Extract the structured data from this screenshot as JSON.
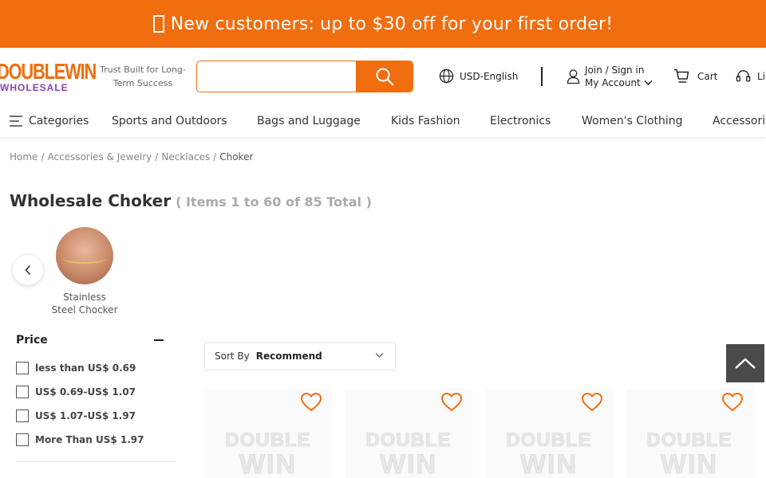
{
  "promo": {
    "text": "New customers: up to $30 off for your first order!"
  },
  "header": {
    "logo_top": "DOUBLEWIN",
    "logo_bottom": "WHOLESALE",
    "tagline": "Trust Built for Long-Term Success",
    "search_placeholder": "",
    "currency_label": "USD-English",
    "account_line1": "Join / Sign in",
    "account_line2": "My Account",
    "cart_label": "Cart",
    "help_label": "Li"
  },
  "nav": {
    "categories_label": "Categories",
    "items": [
      "Sports and Outdoors",
      "Bags and Luggage",
      "Kids Fashion",
      "Electronics",
      "Women's Clothing",
      "Accessori"
    ]
  },
  "breadcrumb": {
    "items": [
      "Home",
      "Accessories & Jewelry",
      "Necklaces"
    ],
    "current": "Choker"
  },
  "page": {
    "title": "Wholesale Choker",
    "count": "( Items 1 to 60 of 85 Total )"
  },
  "subcategories": [
    {
      "label": "Stainless Steel Chocker"
    }
  ],
  "filters": {
    "price_title": "Price",
    "price_options": [
      "less than US$ 0.69",
      "US$ 0.69-US$ 1.07",
      "US$ 1.07-US$ 1.97",
      "More Than US$ 1.97"
    ]
  },
  "sort": {
    "label": "Sort By",
    "value": "Recommend"
  },
  "products": [
    {
      "placeholder_top": "DOUBLE",
      "placeholder_bottom": "WIN"
    },
    {
      "placeholder_top": "DOUBLE",
      "placeholder_bottom": "WIN"
    },
    {
      "placeholder_top": "DOUBLE",
      "placeholder_bottom": "WIN"
    },
    {
      "placeholder_top": "DOUBLE",
      "placeholder_bottom": "WIN"
    }
  ],
  "colors": {
    "brand": "#f06d10",
    "logo_sub": "#8a3fb5",
    "to_top_bg": "#4a4a4a"
  },
  "icons": [
    "gift-icon",
    "search-icon",
    "globe-icon",
    "user-icon",
    "chevron-down-icon",
    "cart-icon",
    "headset-icon",
    "menu-icon",
    "chevron-left-icon",
    "heart-icon",
    "arrow-up-icon"
  ]
}
